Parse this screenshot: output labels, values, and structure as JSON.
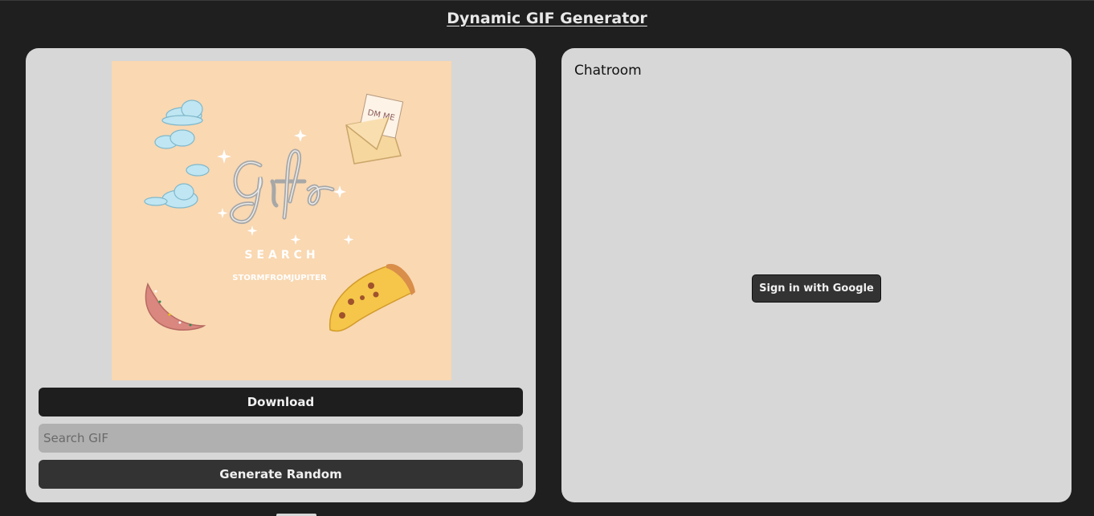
{
  "header": {
    "title": "Dynamic GIF Generator"
  },
  "gif_panel": {
    "gif_text": {
      "word": "Gifs",
      "search": "SEARCH",
      "credit": "STORMFROMJUPITER",
      "note": "DM ME"
    },
    "download_label": "Download",
    "search_placeholder": "Search GIF",
    "search_value": "",
    "random_label": "Generate Random"
  },
  "chat_panel": {
    "title": "Chatroom",
    "sign_in_label": "Sign in with Google"
  },
  "colors": {
    "background": "#1f1f1f",
    "panel": "#d7d7d7",
    "gif_background": "#f9d8b2",
    "button_dark": "#1e1e1e",
    "button_secondary": "#333333",
    "input_background": "#b0b0b0"
  },
  "icons": [
    "cloud-icon",
    "envelope-icon",
    "pizza-icon",
    "donut-icon",
    "sparkle-icon"
  ]
}
